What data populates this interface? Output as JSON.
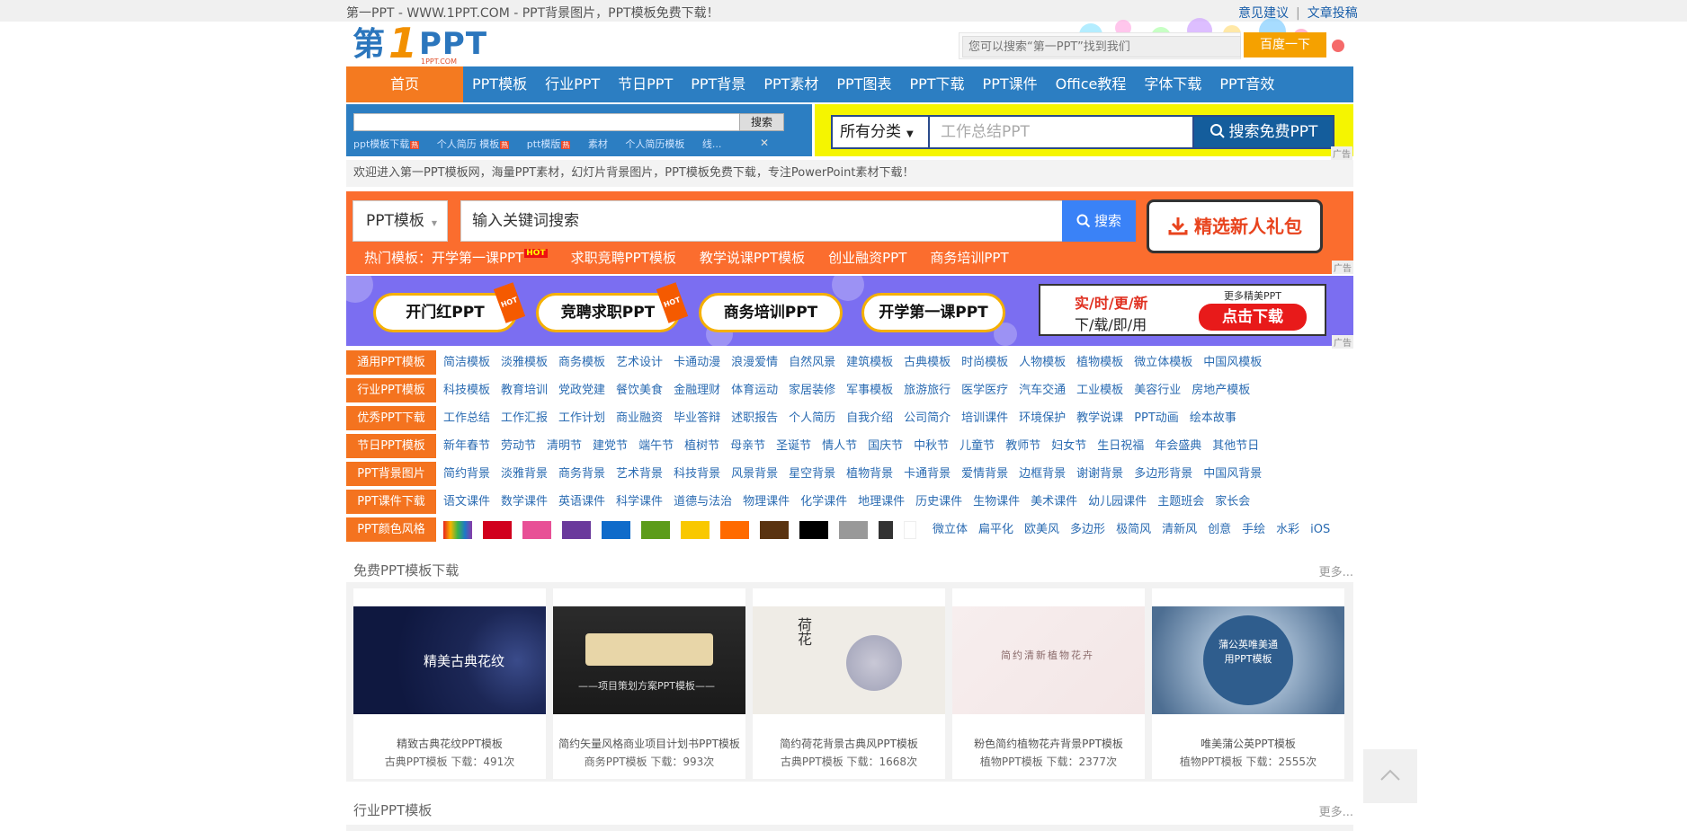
{
  "topbar": {
    "site_desc": "第一PPT - WWW.1PPT.COM - PPT背景图片，PPT模板免费下载！",
    "feedback": "意见建议",
    "sep": "|",
    "contribute": "文章投稿"
  },
  "logo": {
    "part1": "第",
    "part2": "1",
    "part3": "PPT",
    "sub": "1PPT.COM"
  },
  "header_search": {
    "placeholder": "您可以搜索“第一PPT”找到我们",
    "button": "百度一下"
  },
  "nav": {
    "home": "首页",
    "items": [
      "PPT模板",
      "行业PPT",
      "节日PPT",
      "PPT背景",
      "PPT素材",
      "PPT图表",
      "PPT下载",
      "PPT课件",
      "Office教程",
      "字体下载",
      "PPT音效"
    ]
  },
  "search_box1": {
    "button": "搜索",
    "tags": [
      "ppt模板下载",
      "个人简历 模板",
      "ptt模版",
      "素材",
      "个人简历模板",
      "线..."
    ],
    "hot_badges": [
      "热",
      "热",
      "热"
    ]
  },
  "ad_search": {
    "category": "所有分类",
    "placeholder": "工作总结PPT",
    "button": "搜索免费PPT",
    "ad": "广告"
  },
  "welcome": "欢迎进入第一PPT模板网，海量PPT素材，幻灯片背景图片，PPT模板免费下载，专注PowerPoint素材下载！",
  "orange_banner": {
    "select": "PPT模板",
    "placeholder": "输入关键词搜索",
    "button": "搜索",
    "gift": "精选新人礼包",
    "hot_label": "热门模板：开学第一课PPT",
    "hot_badge": "HOT",
    "hot_items": [
      "求职竞聘PPT模板",
      "教学说课PPT模板",
      "创业融资PPT",
      "商务培训PPT"
    ],
    "ad": "广告"
  },
  "purple_banner": {
    "buttons": [
      "开门红PPT",
      "竞聘求职PPT",
      "商务培训PPT",
      "开学第一课PPT"
    ],
    "hot": "HOT",
    "ad_line1": "实/时/更/新",
    "ad_line2": "下/载/即/用",
    "ad_more": "更多精美PPT",
    "ad_btn": "点击下载",
    "ad": "广告"
  },
  "categories": [
    {
      "label": "通用PPT模板",
      "items": [
        "简洁模板",
        "淡雅模板",
        "商务模板",
        "艺术设计",
        "卡通动漫",
        "浪漫爱情",
        "自然风景",
        "建筑模板",
        "古典模板",
        "时尚模板",
        "人物模板",
        "植物模板",
        "微立体模板",
        "中国风模板"
      ]
    },
    {
      "label": "行业PPT模板",
      "items": [
        "科技模板",
        "教育培训",
        "党政党建",
        "餐饮美食",
        "金融理财",
        "体育运动",
        "家居装修",
        "军事模板",
        "旅游旅行",
        "医学医疗",
        "汽车交通",
        "工业模板",
        "美容行业",
        "房地产模板"
      ]
    },
    {
      "label": "优秀PPT下载",
      "items": [
        "工作总结",
        "工作汇报",
        "工作计划",
        "商业融资",
        "毕业答辩",
        "述职报告",
        "个人简历",
        "自我介绍",
        "公司简介",
        "培训课件",
        "环境保护",
        "教学说课",
        "PPT动画",
        "绘本故事"
      ]
    },
    {
      "label": "节日PPT模板",
      "items": [
        "新年春节",
        "劳动节",
        "清明节",
        "建党节",
        "端午节",
        "植树节",
        "母亲节",
        "圣诞节",
        "情人节",
        "国庆节",
        "中秋节",
        "儿童节",
        "教师节",
        "妇女节",
        "生日祝福",
        "年会盛典",
        "其他节日"
      ]
    },
    {
      "label": "PPT背景图片",
      "items": [
        "简约背景",
        "淡雅背景",
        "商务背景",
        "艺术背景",
        "科技背景",
        "风景背景",
        "星空背景",
        "植物背景",
        "卡通背景",
        "爱情背景",
        "边框背景",
        "谢谢背景",
        "多边形背景",
        "中国风背景"
      ]
    },
    {
      "label": "PPT课件下载",
      "items": [
        "语文课件",
        "数学课件",
        "英语课件",
        "科学课件",
        "道德与法治",
        "物理课件",
        "化学课件",
        "地理课件",
        "历史课件",
        "生物课件",
        "美术课件",
        "幼儿园课件",
        "主题班会",
        "家长会"
      ]
    }
  ],
  "colors_row": {
    "label": "PPT颜色风格",
    "swatches": [
      "#d1001d",
      "#e85096",
      "#6a3a9c",
      "#0f6bca",
      "#5c9c1a",
      "#f9c800",
      "#ff6a00",
      "#5a3310",
      "#000000",
      "#999999",
      "#333333"
    ],
    "styles": [
      "微立体",
      "扁平化",
      "欧美风",
      "多边形",
      "极简风",
      "清新风",
      "创意",
      "手绘",
      "水彩",
      "iOS"
    ]
  },
  "free_section": {
    "title": "免费PPT模板下载",
    "more": "更多...",
    "cards": [
      {
        "name": "精致古典花纹PPT模板",
        "meta": "古典PPT模板 下载：491次",
        "img_text": "精美古典花纹"
      },
      {
        "name": "简约矢量风格商业项目计划书PPT模板",
        "meta": "商务PPT模板 下载：993次",
        "img_text": "——项目策划方案PPT模板——"
      },
      {
        "name": "简约荷花背景古典风PPT模板",
        "meta": "古典PPT模板 下载：1668次",
        "img_text": "荷花"
      },
      {
        "name": "粉色简约植物花卉背景PPT模板",
        "meta": "植物PPT模板 下载：2377次",
        "img_text": "简约清新植物花卉"
      },
      {
        "name": "唯美蒲公英PPT模板",
        "meta": "植物PPT模板 下载：2555次",
        "img_text": "蒲公英唯美通用PPT模板"
      }
    ]
  },
  "industry_section": {
    "title": "行业PPT模板",
    "more": "更多..."
  }
}
